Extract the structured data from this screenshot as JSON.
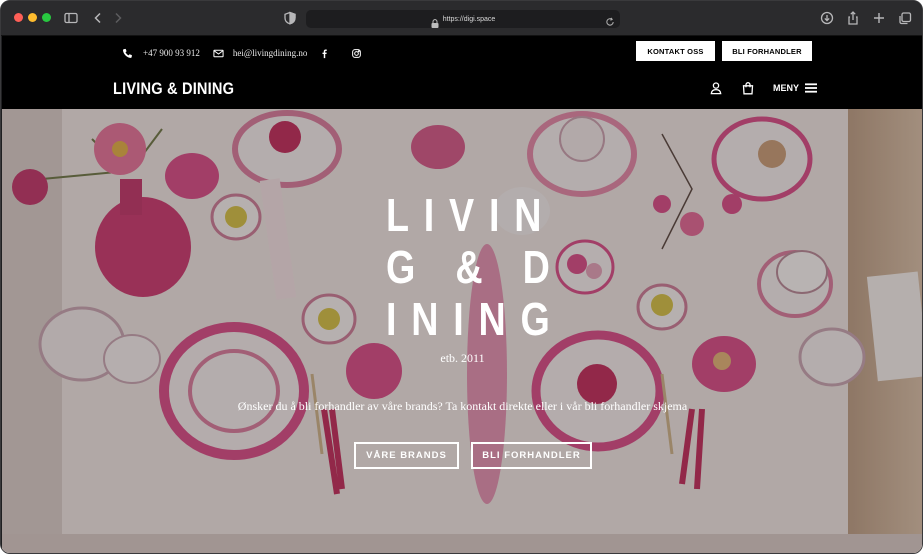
{
  "browser": {
    "url": "https://digi.space",
    "icons": [
      "sidebar-icon",
      "back-icon",
      "forward-icon",
      "shield-icon",
      "lock-icon",
      "reload-icon",
      "download-icon",
      "share-icon",
      "new-tab-icon",
      "tabs-icon"
    ]
  },
  "topbar": {
    "phone": "+47 900 93 912",
    "email": "hei@livingdining.no",
    "social": [
      "facebook-icon",
      "instagram-icon"
    ],
    "contact_button": "KONTAKT OSS",
    "dealer_button": "BLI FORHANDLER",
    "brand": "LIVING & DINING",
    "menu_label": "MENY"
  },
  "hero": {
    "title_lines": [
      "LIVIN",
      "G & D",
      "INING"
    ],
    "subtitle": "etb. 2011",
    "text": "Ønsker du å bli forhandler av våre brands? Ta kontakt direkte eller i vår bli forhandler skjema",
    "brands_button": "VÅRE BRANDS",
    "dealer_button": "BLI FORHANDLER"
  },
  "colors": {
    "header_bg": "#000000",
    "accent_pink": "#d9417a",
    "tablecloth": "#f1ece8"
  }
}
